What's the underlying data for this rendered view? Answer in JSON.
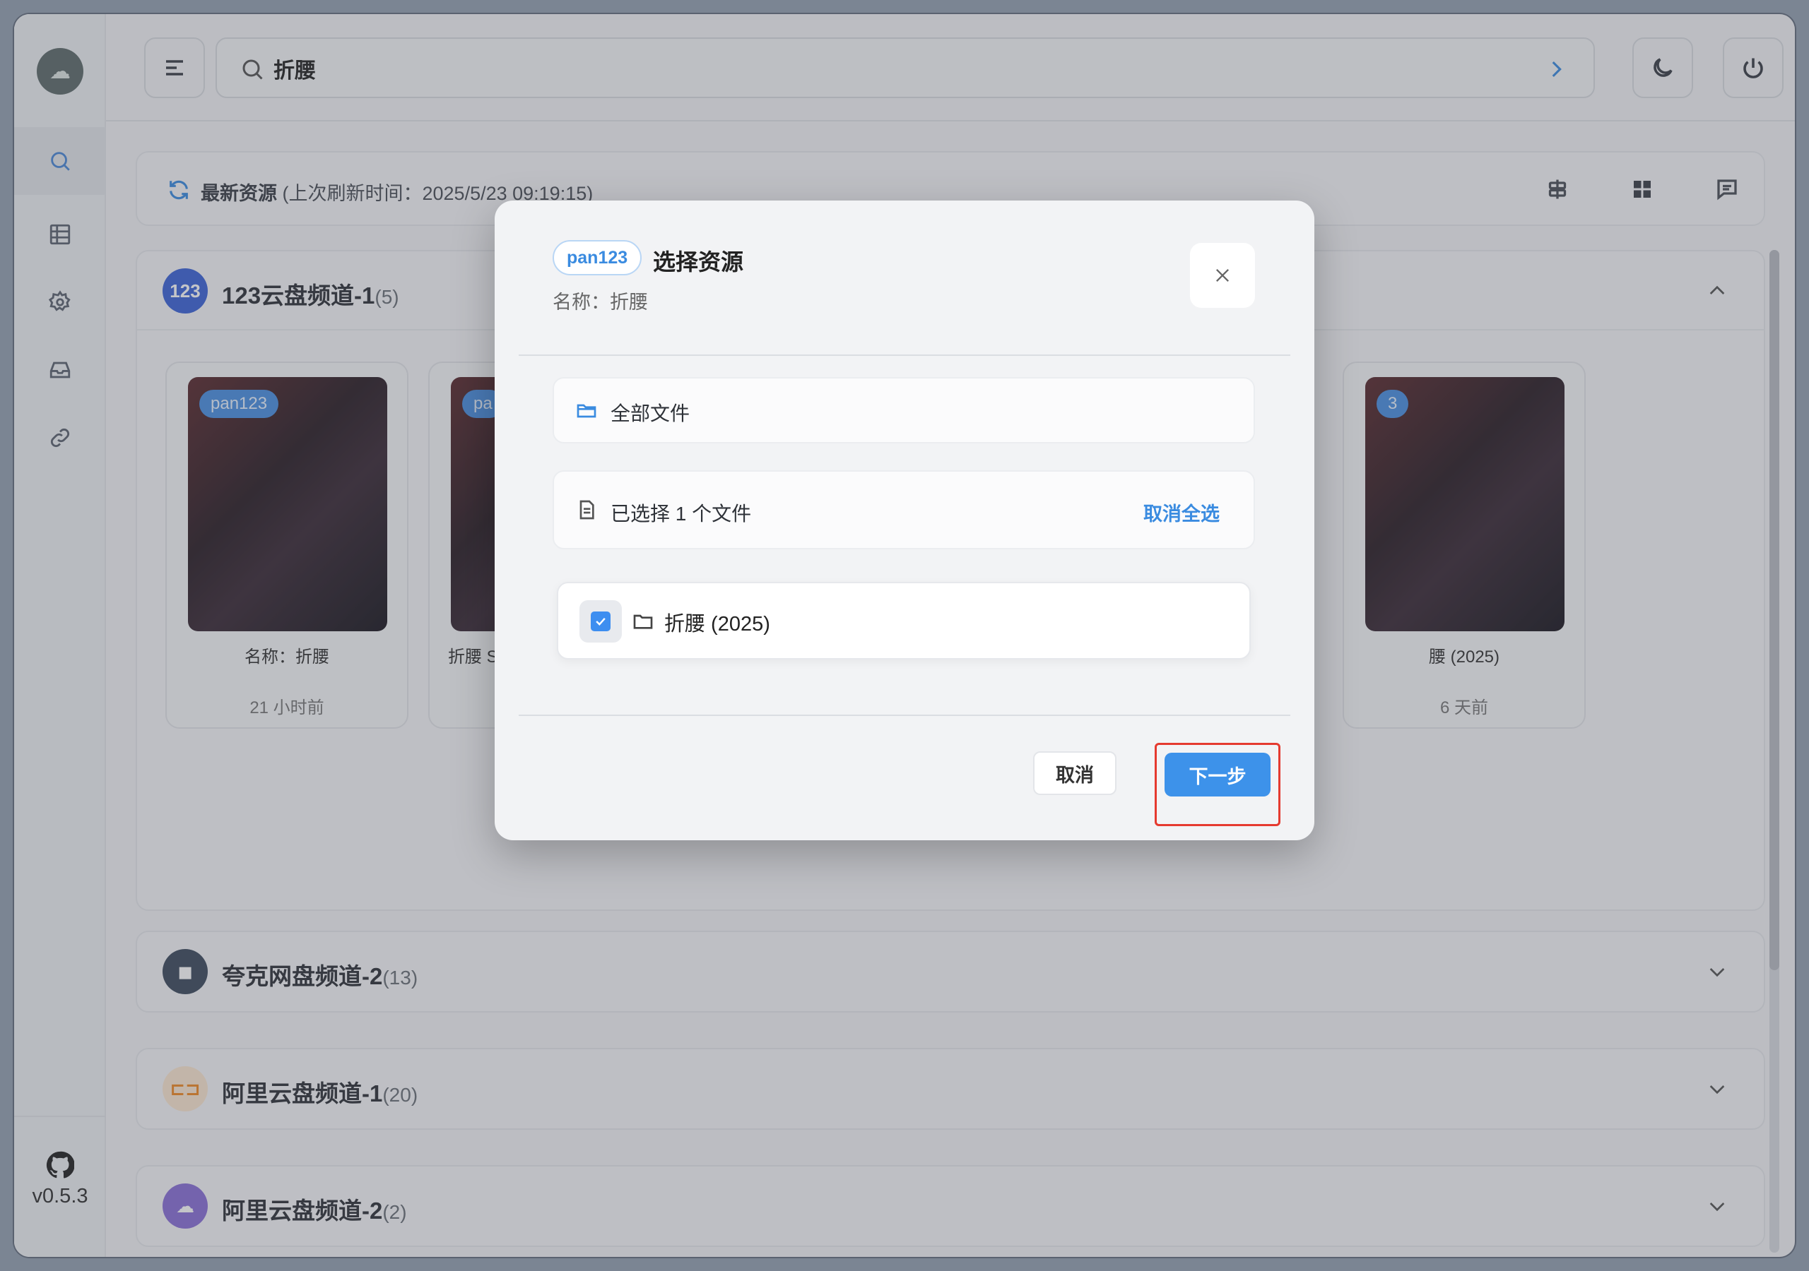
{
  "app": {
    "version": "v0.5.3"
  },
  "search": {
    "value": "折腰"
  },
  "latest": {
    "title": "最新资源",
    "refresh_info": "(上次刷新时间：2025/5/23 09:19:15)"
  },
  "channels": [
    {
      "name": "123云盘频道-1",
      "count": "(5)",
      "icon_text": "123",
      "color": "#3b63d8",
      "expanded": true
    },
    {
      "name": "夸克网盘频道-2",
      "count": "(13)",
      "color": "#3d4b5e",
      "expanded": false
    },
    {
      "name": "阿里云盘频道-1",
      "count": "(20)",
      "color": "#f08a24",
      "expanded": false
    },
    {
      "name": "阿里云盘频道-2",
      "count": "(2)",
      "color": "#8a6fd8",
      "expanded": false
    }
  ],
  "cards": [
    {
      "tag": "pan123",
      "name": "名称：折腰",
      "time": "21 小时前"
    },
    {
      "tag": "pa",
      "name": "折腰 S",
      "time": ""
    },
    {
      "tag": "3",
      "name": "腰 (2025)",
      "time": "6 天前"
    }
  ],
  "modal": {
    "badge": "pan123",
    "title": "选择资源",
    "subtitle": "名称：折腰",
    "all_files": "全部文件",
    "selected_info": "已选择 1 个文件",
    "deselect_all": "取消全选",
    "file_name": "折腰 (2025)",
    "file_checked": true,
    "cancel_label": "取消",
    "next_label": "下一步"
  },
  "colors": {
    "accent": "#3d92ea",
    "highlight": "#e53a2f"
  }
}
